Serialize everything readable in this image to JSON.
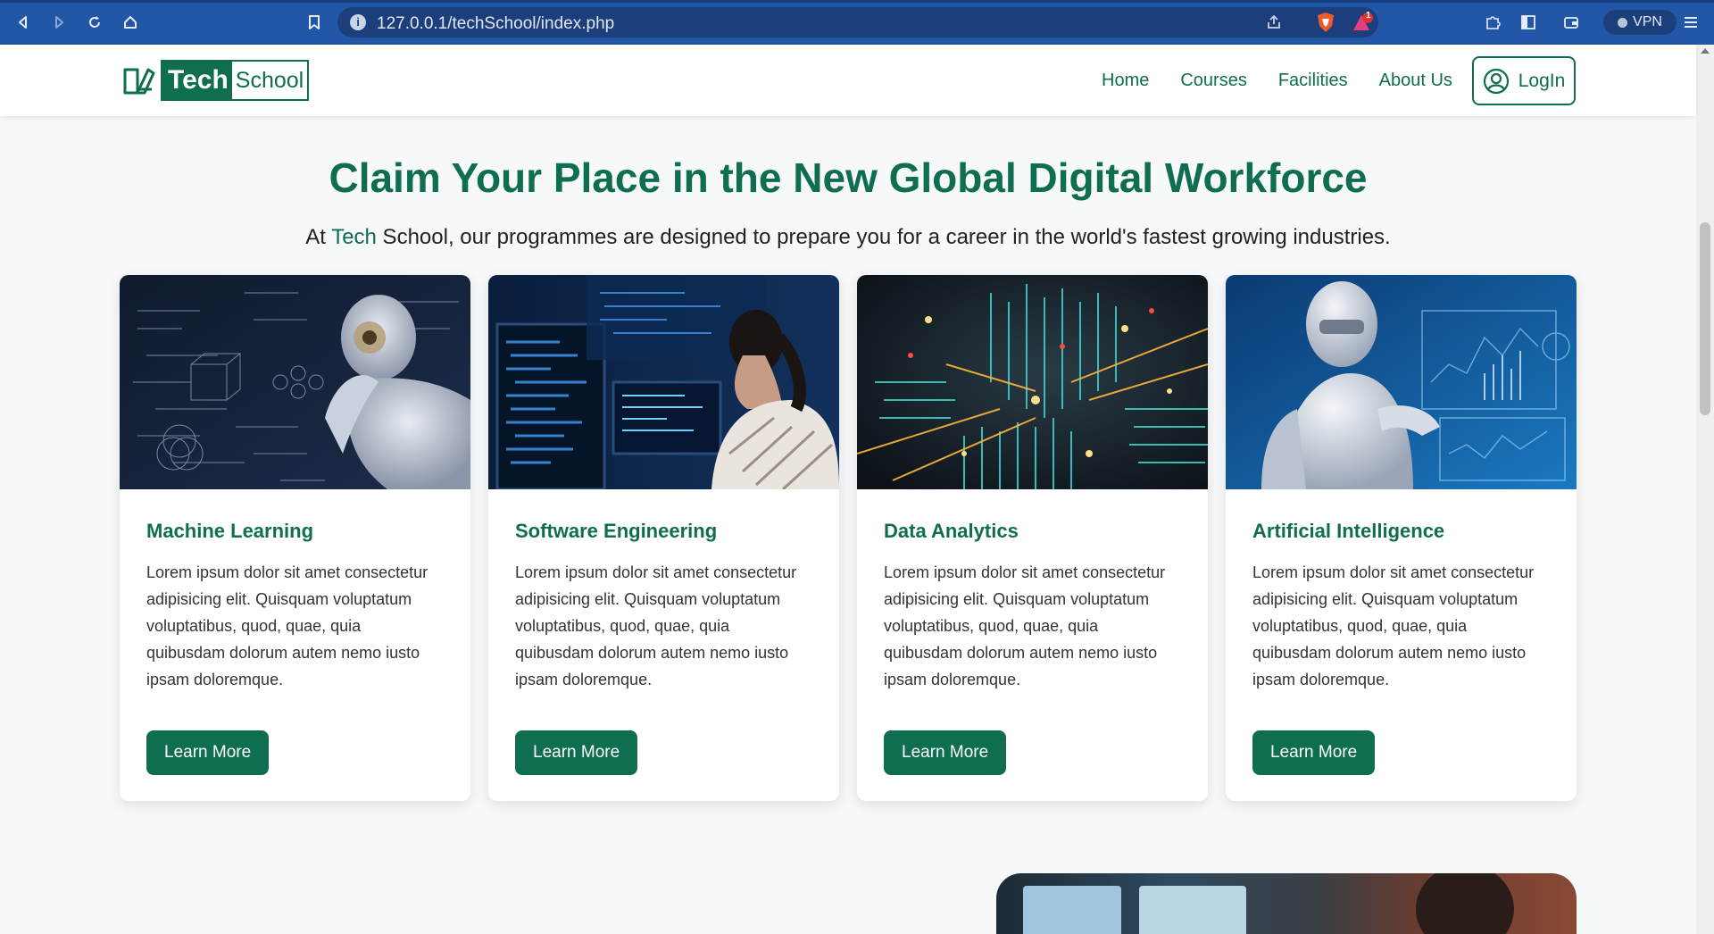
{
  "browser": {
    "url": "127.0.0.1/techSchool/index.php",
    "vpn_label": "VPN",
    "notification_count": "1"
  },
  "site": {
    "logo": {
      "tech": "Tech",
      "school": "School"
    },
    "nav": {
      "items": [
        "Home",
        "Courses",
        "Facilities",
        "About Us"
      ],
      "login_label": "LogIn"
    }
  },
  "hero": {
    "headline": "Claim Your Place in the New Global Digital Workforce",
    "sub_prefix": "At ",
    "sub_accent": "Tech",
    "sub_suffix": " School, our programmes are designed to prepare you for a career in the world's fastest growing industries."
  },
  "cards": [
    {
      "title": "Machine Learning",
      "text": "Lorem ipsum dolor sit amet consectetur adipisicing elit. Quisquam voluptatum voluptatibus, quod, quae, quia quibusdam dolorum autem nemo iusto ipsam doloremque.",
      "button": "Learn More"
    },
    {
      "title": "Software Engineering",
      "text": "Lorem ipsum dolor sit amet consectetur adipisicing elit. Quisquam voluptatum voluptatibus, quod, quae, quia quibusdam dolorum autem nemo iusto ipsam doloremque.",
      "button": "Learn More"
    },
    {
      "title": "Data Analytics",
      "text": "Lorem ipsum dolor sit amet consectetur adipisicing elit. Quisquam voluptatum voluptatibus, quod, quae, quia quibusdam dolorum autem nemo iusto ipsam doloremque.",
      "button": "Learn More"
    },
    {
      "title": "Artificial Intelligence",
      "text": "Lorem ipsum dolor sit amet consectetur adipisicing elit. Quisquam voluptatum voluptatibus, quod, quae, quia quibusdam dolorum autem nemo iusto ipsam doloremque.",
      "button": "Learn More"
    }
  ],
  "colors": {
    "brand": "#0e6e4f",
    "browser_chrome": "#2256a6"
  }
}
